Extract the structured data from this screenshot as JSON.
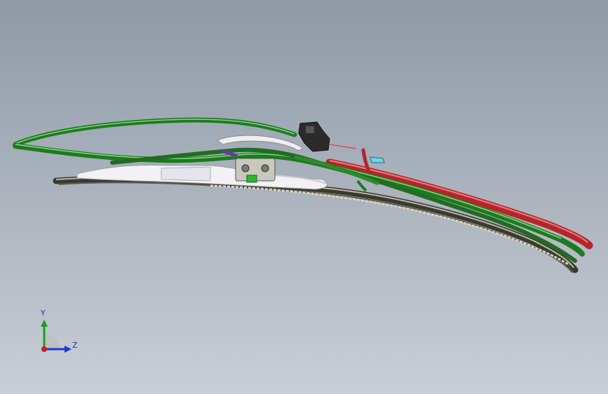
{
  "viewport": {
    "background_top": "#8f99a6",
    "background_bottom": "#c9ced6"
  },
  "model": {
    "frame_color": "#1e7a1e",
    "frame_highlight": "#7fd47f",
    "rail_color": "#b3262b",
    "rail_highlight": "#f07a7a",
    "blade_color": "#3a3a2e",
    "blade_light": "#b9b9a8",
    "housing_color": "#f2f2f5",
    "connector_color": "#2b2b2b"
  },
  "triad": {
    "y_label": "Y",
    "z_label": "Z",
    "y_color": "#1aa01a",
    "z_color": "#1a3ad0",
    "x_color": "#d01a1a"
  }
}
